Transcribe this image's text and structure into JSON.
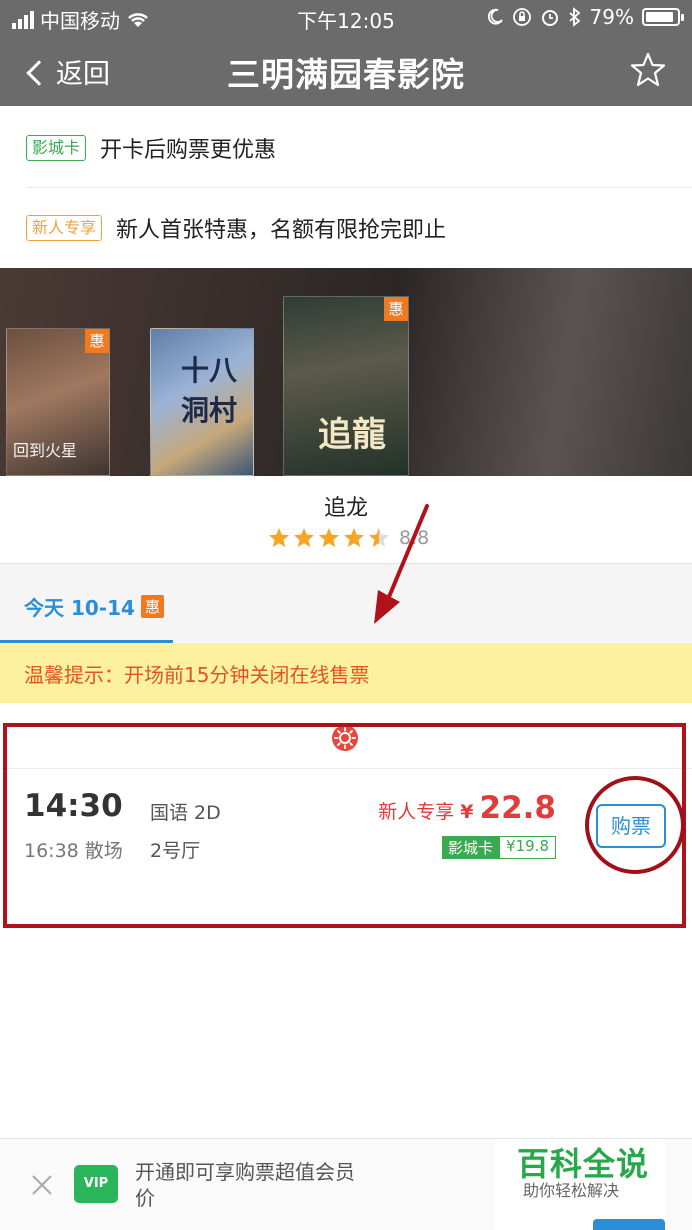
{
  "status_bar": {
    "carrier": "中国移动",
    "time": "下午12:05",
    "battery": "79%"
  },
  "nav": {
    "back_label": "返回",
    "title": "三明满园春影院"
  },
  "promos": [
    {
      "tag": "影城卡",
      "text": "开卡后购票更优惠"
    },
    {
      "tag": "新人专享",
      "text": "新人首张特惠，名额有限抢完即止"
    }
  ],
  "posters": [
    {
      "title": "回到火星",
      "badge": "惠"
    },
    {
      "title": "十八洞村",
      "badge": ""
    },
    {
      "title": "追龍",
      "badge": "惠"
    }
  ],
  "movie": {
    "name": "追龙",
    "rating": 8.8,
    "rating_label": "8.8"
  },
  "tab": {
    "today_label": "今天 10-14",
    "badge": "惠"
  },
  "notice": "温馨提示：开场前15分钟关闭在线售票",
  "showtime": {
    "start": "14:30",
    "end": "16:38 散场",
    "language": "国语 2D",
    "hall": "2号厅",
    "new_user_label": "新人专享",
    "yen": "¥",
    "price": "22.8",
    "card_label": "影城卡",
    "card_price": "¥19.8",
    "buy_label": "购票"
  },
  "bottom_bar": {
    "vip_label": "VIP",
    "vip_text": "开通即可享购票超值会员价"
  },
  "watermark": {
    "title": "百科全说",
    "subtitle": "助你轻松解决"
  },
  "colors": {
    "accent_blue": "#2a8fd6",
    "price_red": "#e23b3b",
    "green": "#3aa94f",
    "orange": "#f07a1f",
    "annotation_red": "#b0121c"
  }
}
